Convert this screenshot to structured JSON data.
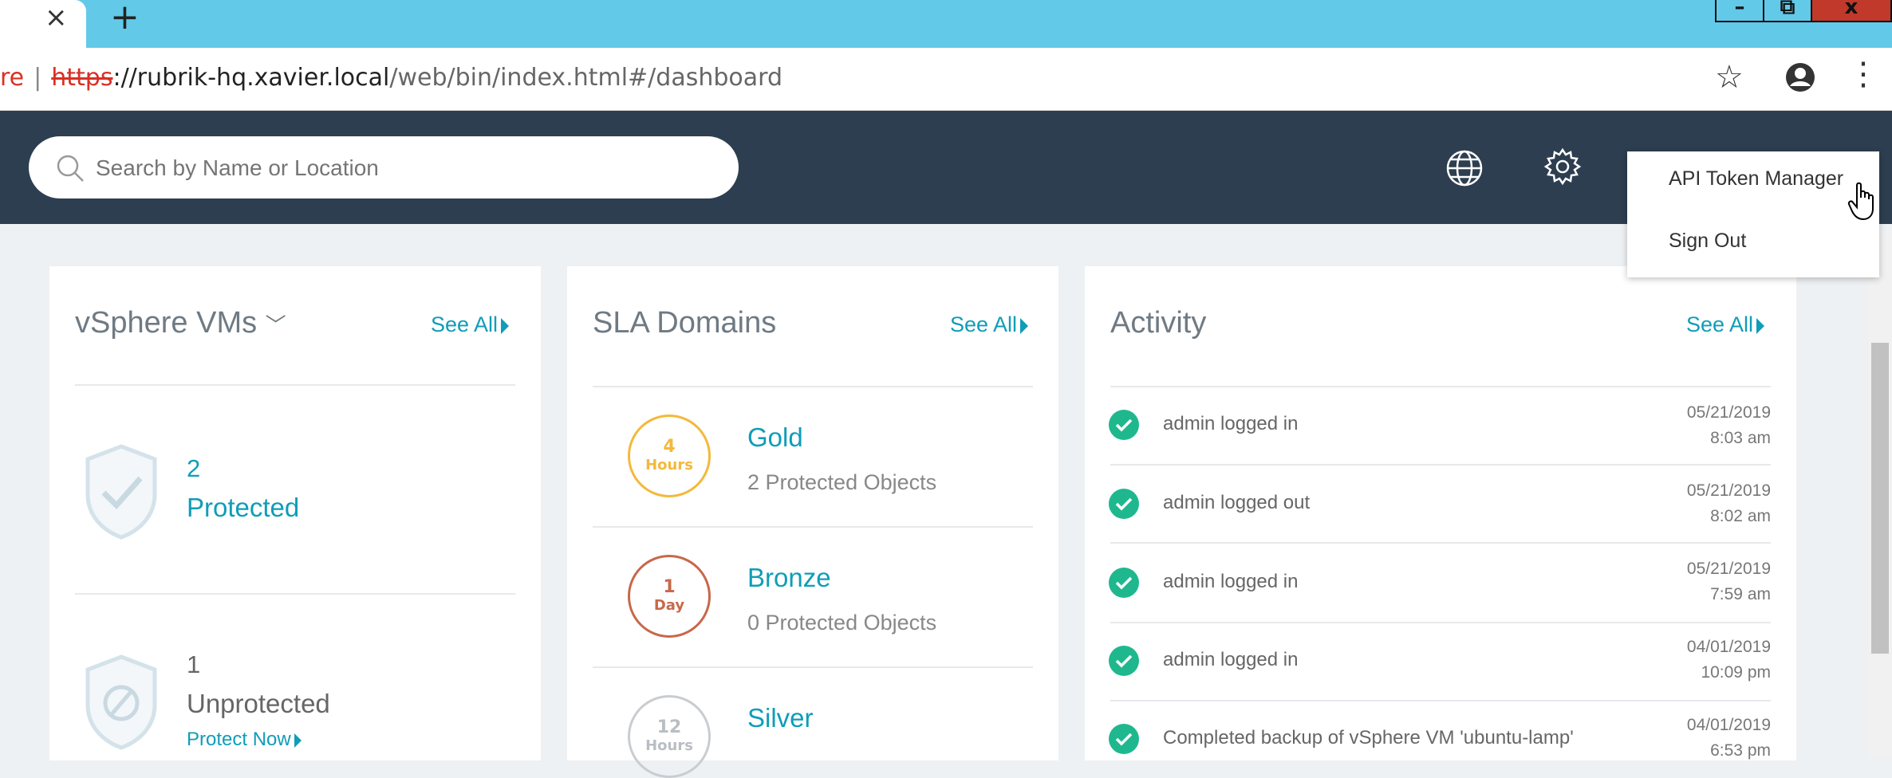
{
  "browser": {
    "tab_close_glyph": "×",
    "new_tab_glyph": "+",
    "url": {
      "insecure_label": "re",
      "separator": "|",
      "scheme": "https",
      "host_prefix": "://rubrik-hq.xavier.local",
      "path": "/web/bin/index.html#/dashboard"
    },
    "window_controls": {
      "minimize": "–",
      "maximize": "⧉",
      "close": "x"
    }
  },
  "search": {
    "placeholder": "Search by Name or Location"
  },
  "user_menu": {
    "items": [
      "API Token Manager",
      "Sign Out"
    ]
  },
  "cards": {
    "vms": {
      "title": "vSphere VMs",
      "see_all": "See All",
      "protected": {
        "count": "2",
        "label": "Protected"
      },
      "unprotected": {
        "count": "1",
        "label": "Unprotected",
        "action": "Protect Now"
      }
    },
    "sla": {
      "title": "SLA Domains",
      "see_all": "See All",
      "items": [
        {
          "value": "4",
          "unit": "Hours",
          "name": "Gold",
          "objects": "2 Protected Objects",
          "color": "#f3b93c"
        },
        {
          "value": "1",
          "unit": "Day",
          "name": "Bronze",
          "objects": "0 Protected Objects",
          "color": "#c8684a"
        },
        {
          "value": "12",
          "unit": "Hours",
          "name": "Silver",
          "objects": "",
          "color": "#b9bec3"
        }
      ]
    },
    "activity": {
      "title": "Activity",
      "see_all": "See All",
      "items": [
        {
          "text": "admin logged in",
          "date": "05/21/2019",
          "time": "8:03 am"
        },
        {
          "text": "admin logged out",
          "date": "05/21/2019",
          "time": "8:02 am"
        },
        {
          "text": "admin logged in",
          "date": "05/21/2019",
          "time": "7:59 am"
        },
        {
          "text": "admin logged in",
          "date": "04/01/2019",
          "time": "10:09 pm"
        },
        {
          "text": "Completed backup of vSphere VM 'ubuntu-lamp'",
          "date": "04/01/2019",
          "time": "6:53 pm"
        }
      ]
    }
  },
  "colors": {
    "header_bg": "#2d3e50",
    "accent": "#0f9db8",
    "tab_bar": "#62c9e9",
    "success": "#1fb88e"
  }
}
